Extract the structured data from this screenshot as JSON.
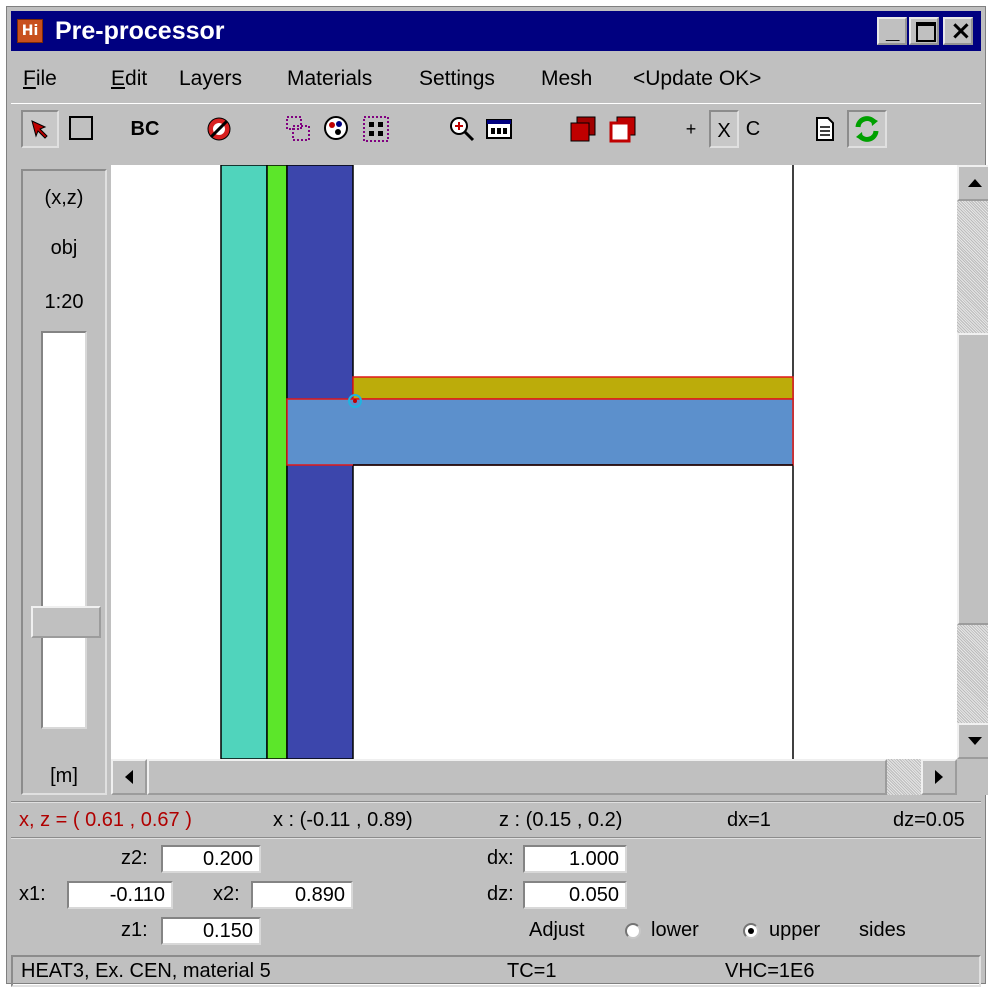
{
  "window": {
    "title": "Pre-processor",
    "icon_label": "Hi",
    "minimize_glyph": "_",
    "maximize_glyph": "□",
    "close_glyph": "×"
  },
  "menu": {
    "file": "ile",
    "file_mnemonic": "F",
    "edit": "dit",
    "edit_mnemonic": "E",
    "layers": "Layers",
    "materials": "Materials",
    "settings": "Settings",
    "mesh": "Mesh",
    "update": "<Update OK>"
  },
  "toolbar": {
    "bc_label": "BC",
    "plus_label": "+",
    "x_label": "X",
    "c_label": "C"
  },
  "side_panel": {
    "coords_label": "(x,z)",
    "obj_label": "obj",
    "scale_label": "1:20",
    "unit_label": "[m]",
    "slider_level": 0.75
  },
  "drawing": {
    "colors": {
      "cyan_layer": "#50d4bc",
      "green_layer": "#5ce62a",
      "blue_layer": "#3c46ac",
      "olive_layer": "#bcac0a",
      "slab": "#5c90cc",
      "outline": "#e01818"
    }
  },
  "status": {
    "cursor": "x, z = ( 0.61 ,  0.67 )",
    "cursor_color": "#b00000",
    "x_range": "x : (-0.11 ,  0.89)",
    "z_range": "z : (0.15 ,  0.2)",
    "dx": "dx=1",
    "dz": "dz=0.05"
  },
  "fields": {
    "z2_label": "z2:",
    "z2_value": "0.200",
    "x1_label": "x1:",
    "x1_value": "-0.110",
    "x2_label": "x2:",
    "x2_value": "0.890",
    "z1_label": "z1:",
    "z1_value": "0.150",
    "dx_label": "dx:",
    "dx_value": "1.000",
    "dz_label": "dz:",
    "dz_value": "0.050",
    "adjust_label": "Adjust",
    "lower_label": "lower",
    "upper_label": "upper",
    "sides_label": "sides",
    "selected_side": "upper"
  },
  "bottom": {
    "material": "HEAT3, Ex. CEN, material 5",
    "tc": "TC=1",
    "vhc": "VHC=1E6"
  }
}
